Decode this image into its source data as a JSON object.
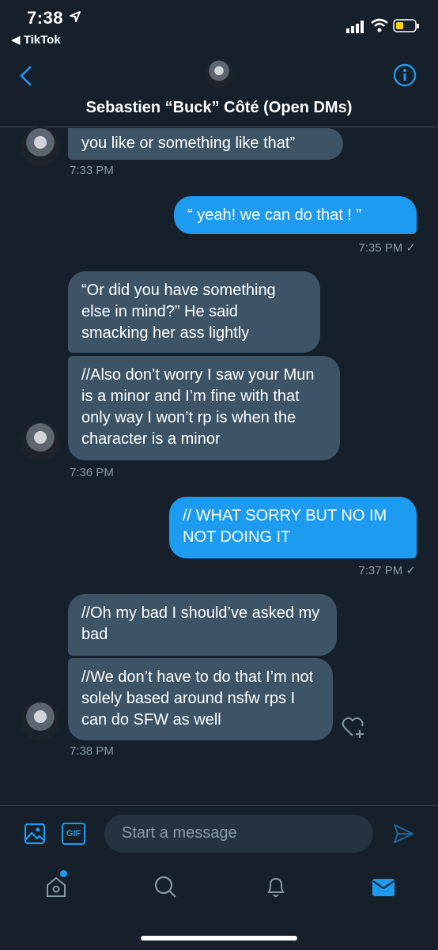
{
  "status_bar": {
    "time": "7:38",
    "back_app": "◀ TikTok"
  },
  "header": {
    "title": "Sebastien “Buck” Côté (Open DMs)"
  },
  "messages": [
    {
      "dir": "in",
      "text": "you like or something like that”"
    },
    {
      "ts": "7:33 PM"
    },
    {
      "dir": "out",
      "text": "“ yeah! we can do that ! ”"
    },
    {
      "ts": "7:35 PM ✓"
    },
    {
      "dir": "in",
      "text": "“Or did you have something else in mind?” He said smacking her ass lightly"
    },
    {
      "dir": "in",
      "text": "//Also don’t worry I saw your Mun is a minor and I’m fine with that only way I won’t rp is when the character is a minor"
    },
    {
      "ts": "7:36 PM"
    },
    {
      "dir": "out",
      "text": "// WHAT SORRY BUT NO IM NOT DOING IT"
    },
    {
      "ts": "7:37 PM ✓"
    },
    {
      "dir": "in",
      "text": "//Oh my bad I should’ve asked my bad"
    },
    {
      "dir": "in",
      "text": "//We don’t have to do that I’m not solely based around nsfw rps I can do SFW as well"
    },
    {
      "ts": "7:38 PM"
    }
  ],
  "composer": {
    "placeholder": "Start a message",
    "gif_label": "GIF"
  },
  "colors": {
    "accent": "#1d9bf0",
    "background": "#15202b",
    "incoming_bubble": "#3d5466"
  },
  "icons": [
    "back-chevron-icon",
    "info-icon",
    "image-icon",
    "gif-icon",
    "send-icon",
    "home-icon",
    "search-icon",
    "notifications-icon",
    "messages-icon",
    "react-heart-icon"
  ]
}
